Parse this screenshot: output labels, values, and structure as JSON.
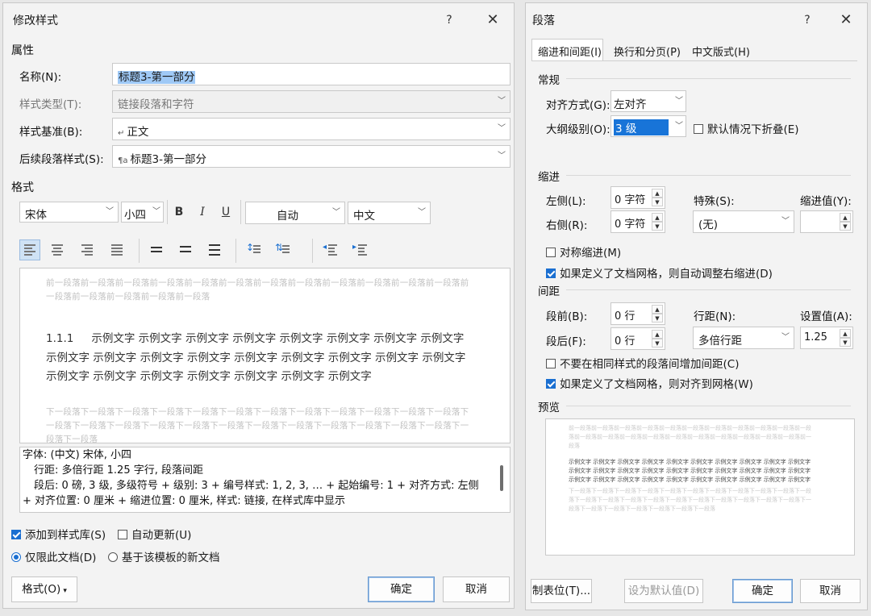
{
  "left": {
    "title": "修改样式",
    "help": "?",
    "close": "✕",
    "props_header": "属性",
    "name_label": "名称(N):",
    "name_value": "标题3-第一部分",
    "type_label": "样式类型(T):",
    "type_value": "链接段落和字符",
    "base_label": "样式基准(B):",
    "base_value": "正文",
    "next_label": "后续段落样式(S):",
    "next_value": "标题3-第一部分",
    "format_header": "格式",
    "font": "宋体",
    "size": "小四",
    "bold": "B",
    "italic": "I",
    "underline": "U",
    "color": "自动",
    "lang": "中文",
    "preview_before": "前一段落前一段落前一段落前一段落前一段落前一段落前一段落前一段落前一段落前一段落前一段落前一段落前一段落前一段落前一段落前一段落前一段落",
    "preview_number": "1.1.1",
    "preview_sample": "示例文字 示例文字 示例文字 示例文字 示例文字 示例文字 示例文字 示例文字 示例文字 示例文字 示例文字 示例文字 示例文字 示例文字 示例文字 示例文字 示例文字 示例文字 示例文字 示例文字 示例文字 示例文字 示例文字 示例文字",
    "preview_after": "下一段落下一段落下一段落下一段落下一段落下一段落下一段落下一段落下一段落下一段落下一段落下一段落下一段落下一段落下一段落下一段落下一段落下一段落下一段落下一段落下一段落下一段落下一段落下一段落下一段落下一段落",
    "desc_line1": "字体: (中文) 宋体, 小四",
    "desc_line2": "行距: 多倍行距 1.25 字行, 段落间距",
    "desc_line3": "段后: 0 磅, 3 级, 多级符号 + 级别: 3 + 编号样式: 1, 2, 3, … + 起始编号: 1 + 对齐方式: 左侧 + 对齐位置:  0 厘米 + 缩进位置:  0 厘米, 样式: 链接, 在样式库中显示",
    "add_gallery": "添加到样式库(S)",
    "auto_update": "自动更新(U)",
    "only_doc": "仅限此文档(D)",
    "new_docs": "基于该模板的新文档",
    "format_btn": "格式(O)",
    "ok": "确定",
    "cancel": "取消"
  },
  "right": {
    "title": "段落",
    "help": "?",
    "close": "✕",
    "tabs": [
      "缩进和间距(I)",
      "换行和分页(P)",
      "中文版式(H)"
    ],
    "general": "常规",
    "align_label": "对齐方式(G):",
    "align_value": "左对齐",
    "outline_label": "大纲级别(O):",
    "outline_value": "3 级",
    "collapse": "默认情况下折叠(E)",
    "indent": "缩进",
    "left_label": "左侧(L):",
    "left_value": "0 字符",
    "right_label": "右侧(R):",
    "right_value": "0 字符",
    "special_label": "特殊(S):",
    "special_value": "(无)",
    "indent_by_label": "缩进值(Y):",
    "mirror": "对称缩进(M)",
    "auto_right": "如果定义了文档网格，则自动调整右缩进(D)",
    "spacing": "间距",
    "before_label": "段前(B):",
    "before_value": "0 行",
    "after_label": "段后(F):",
    "after_value": "0 行",
    "line_label": "行距(N):",
    "line_value": "多倍行距",
    "at_label": "设置值(A):",
    "at_value": "1.25",
    "no_space": "不要在相同样式的段落间增加间距(C)",
    "snap_grid": "如果定义了文档网格，则对齐到网格(W)",
    "preview": "预览",
    "pv_before": "前一段落前一段落前一段落前一段落前一段落前一段落前一段落前一段落前一段落前一段落前一段落前一段落前一段落前一段落前一段落前一段落前一段落前一段落前一段落前一段落前一段落前一段落",
    "pv_sample": "示例文字 示例文字 示例文字 示例文字 示例文字 示例文字 示例文字 示例文字 示例文字 示例文字 示例文字 示例文字 示例文字 示例文字 示例文字 示例文字 示例文字 示例文字 示例文字 示例文字 示例文字 示例文字 示例文字 示例文字 示例文字 示例文字 示例文字 示例文字 示例文字 示例文字",
    "pv_after": "下一段落下一段落下一段落下一段落下一段落下一段落下一段落下一段落下一段落下一段落下一段落下一段落下一段落下一段落下一段落下一段落下一段落下一段落下一段落下一段落下一段落下一段落下一段落下一段落下一段落下一段落下一段落下一段落",
    "tabs_btn": "制表位(T)...",
    "default_btn": "设为默认值(D)",
    "ok": "确定",
    "cancel": "取消"
  }
}
